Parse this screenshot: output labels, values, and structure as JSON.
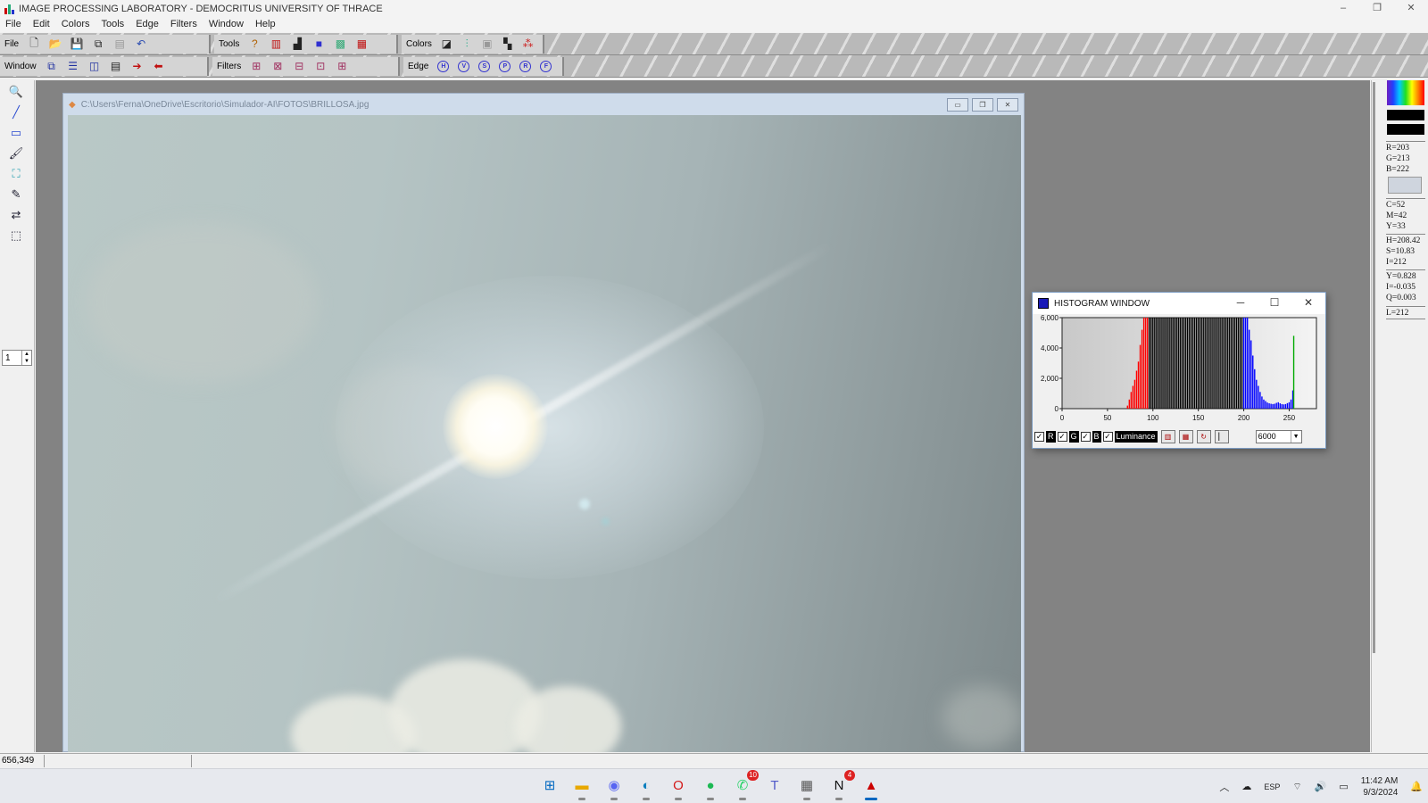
{
  "window": {
    "title": "IMAGE PROCESSING LABORATORY - DEMOCRITUS UNIVERSITY OF THRACE",
    "controls": [
      "–",
      "❐",
      "✕"
    ]
  },
  "menu": [
    "File",
    "Edit",
    "Colors",
    "Tools",
    "Edge",
    "Filters",
    "Window",
    "Help"
  ],
  "toolbar1": {
    "file_label": "File",
    "tools_label": "Tools",
    "colors_label": "Colors"
  },
  "toolbar2": {
    "window_label": "Window",
    "filters_label": "Filters",
    "edge_label": "Edge",
    "edge_buttons": [
      "H",
      "V",
      "S",
      "P",
      "R",
      "F"
    ]
  },
  "left_tools": [
    "magnifier-icon",
    "line-icon",
    "rectangle-icon",
    "brush-icon",
    "flood-fill-icon",
    "pencil-icon",
    "move-icon",
    "selection-icon"
  ],
  "spinner": {
    "value": "1"
  },
  "image_window": {
    "path": "C:\\Users\\Ferna\\OneDrive\\Escritorio\\Simulador-AI\\FOTOS\\BRILLOSA.jpg",
    "controls": [
      "▭",
      "❐",
      "✕"
    ]
  },
  "color_info": {
    "rgb": [
      "R=203",
      "G=213",
      "B=222"
    ],
    "cmy": [
      "C=52",
      "M=42",
      "Y=33"
    ],
    "hsi": [
      "H=208.42",
      "S=10.83",
      "I=212"
    ],
    "yiq": [
      "Y=0.828",
      "I=-0.035",
      "Q=0.003"
    ],
    "lum": [
      "L=212"
    ]
  },
  "histogram": {
    "title": "HISTOGRAM WINDOW",
    "channels": [
      {
        "check": "✓",
        "label": "R"
      },
      {
        "check": "✓",
        "label": "G"
      },
      {
        "check": "✓",
        "label": "B"
      },
      {
        "check": "✓",
        "label": "Luminance"
      }
    ],
    "scale_value": "6000",
    "colors": {
      "red": "#ff0000",
      "blue": "#0000ff",
      "black": "#000000",
      "green": "#00aa00"
    }
  },
  "chart_data": {
    "type": "bar",
    "title": "",
    "xlim": [
      0,
      280
    ],
    "ylim": [
      0,
      6000
    ],
    "x_ticks": [
      0,
      50,
      100,
      150,
      200,
      250
    ],
    "x_tick_labels": [
      "0",
      "50",
      "100",
      "150",
      "200",
      "250"
    ],
    "y_ticks": [
      0,
      2000,
      4000,
      6000
    ],
    "y_tick_labels": [
      "0",
      "2,000",
      "4,000",
      "6,000"
    ],
    "grid": false,
    "series": [
      {
        "name": "R",
        "color": "#ff0000",
        "x": [
          72,
          74,
          76,
          78,
          80,
          82,
          84,
          86,
          88,
          90,
          92,
          94
        ],
        "values": [
          200,
          600,
          1100,
          1500,
          1900,
          2500,
          3100,
          4200,
          5200,
          6000,
          6000,
          6000
        ]
      },
      {
        "name": "Luminance",
        "color": "#000000",
        "x": [
          96,
          98,
          100,
          102,
          104,
          106,
          108,
          110,
          112,
          114,
          116,
          118,
          120,
          122,
          124,
          126,
          128,
          130,
          132,
          134,
          136,
          138,
          140,
          142,
          144,
          146,
          148,
          150,
          152,
          154,
          156,
          158,
          160,
          162,
          164,
          166,
          168,
          170,
          172,
          174,
          176,
          178,
          180,
          182,
          184,
          186,
          188,
          190,
          192,
          194,
          196,
          198
        ],
        "values": [
          6000,
          6000,
          6000,
          6000,
          6000,
          6000,
          6000,
          6000,
          6000,
          6000,
          6000,
          6000,
          6000,
          6000,
          6000,
          6000,
          6000,
          6000,
          6000,
          6000,
          6000,
          6000,
          6000,
          6000,
          6000,
          6000,
          6000,
          6000,
          6000,
          6000,
          6000,
          6000,
          6000,
          6000,
          6000,
          6000,
          6000,
          6000,
          6000,
          6000,
          6000,
          6000,
          6000,
          6000,
          6000,
          6000,
          6000,
          6000,
          6000,
          6000,
          6000,
          6000
        ]
      },
      {
        "name": "B",
        "color": "#0000ff",
        "x": [
          200,
          202,
          204,
          206,
          208,
          210,
          212,
          214,
          216,
          218,
          220,
          222,
          224,
          226,
          228,
          230,
          232,
          234,
          236,
          238,
          240,
          242,
          244,
          246,
          248,
          250,
          252,
          254
        ],
        "values": [
          6000,
          6000,
          6000,
          5200,
          4500,
          3500,
          2600,
          1900,
          1500,
          1100,
          800,
          600,
          500,
          400,
          350,
          320,
          300,
          320,
          380,
          420,
          350,
          300,
          280,
          300,
          360,
          420,
          600,
          1200
        ]
      },
      {
        "name": "G",
        "color": "#00aa00",
        "x": [
          255
        ],
        "values": [
          4800
        ]
      }
    ]
  },
  "status": {
    "coords": "656,349"
  },
  "taskbar": {
    "apps": [
      {
        "name": "start",
        "glyph": "⊞",
        "color": "#0067c0"
      },
      {
        "name": "file-explorer",
        "glyph": "▬",
        "color": "#e8a800"
      },
      {
        "name": "discord",
        "glyph": "◉",
        "color": "#5865f2"
      },
      {
        "name": "edge",
        "glyph": "◐",
        "color": "#0b7fbe"
      },
      {
        "name": "opera",
        "glyph": "O",
        "color": "#d41a1a"
      },
      {
        "name": "spotify",
        "glyph": "●",
        "color": "#1db954"
      },
      {
        "name": "whatsapp",
        "glyph": "✆",
        "color": "#25d366",
        "badge": "10"
      },
      {
        "name": "teams",
        "glyph": "T",
        "color": "#5059c9"
      },
      {
        "name": "calculator",
        "glyph": "▦",
        "color": "#555"
      },
      {
        "name": "notion",
        "glyph": "N",
        "color": "#111",
        "badge": "4"
      },
      {
        "name": "image-processing-lab",
        "glyph": "▲",
        "color": "#c00"
      }
    ],
    "tray": {
      "language": "ESP",
      "time": "11:42 AM",
      "date": "9/3/2024"
    }
  }
}
